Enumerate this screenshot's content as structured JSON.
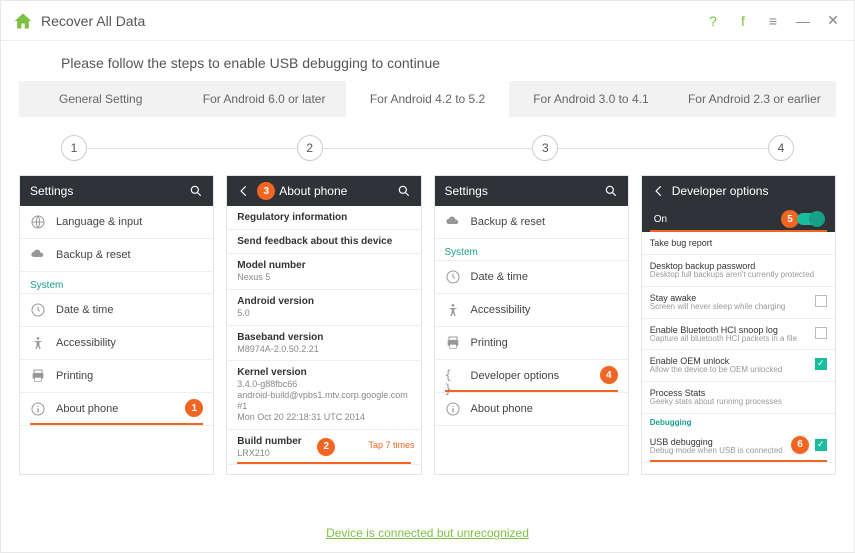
{
  "titlebar": {
    "title": "Recover All Data"
  },
  "instruction": "Please follow the steps to enable USB debugging to continue",
  "tabs": [
    "General Setting",
    "For Android 6.0 or later",
    "For Android 4.2 to 5.2",
    "For Android 3.0 to 4.1",
    "For Android 2.3 or earlier"
  ],
  "active_tab": 2,
  "steps": [
    "1",
    "2",
    "3",
    "4"
  ],
  "panel1": {
    "header": "Settings",
    "rows": [
      {
        "icon": "globe",
        "label": "Language & input"
      },
      {
        "icon": "cloud",
        "label": "Backup & reset"
      }
    ],
    "section": "System",
    "system_rows": [
      {
        "icon": "clock",
        "label": "Date & time"
      },
      {
        "icon": "accessibility",
        "label": "Accessibility"
      },
      {
        "icon": "printer",
        "label": "Printing"
      },
      {
        "icon": "info",
        "label": "About phone",
        "badge": "1",
        "underline": true
      }
    ]
  },
  "panel2": {
    "header": "About phone",
    "badge": "3",
    "rows": [
      {
        "label": "Regulatory information"
      },
      {
        "label": "Send feedback about this device"
      }
    ],
    "info": [
      {
        "label": "Model number",
        "value": "Nexus 5"
      },
      {
        "label": "Android version",
        "value": "5.0"
      },
      {
        "label": "Baseband version",
        "value": "M8974A-2.0.50.2.21"
      },
      {
        "label": "Kernel version",
        "value": "3.4.0-g88fbc66\nandroid-build@vpbs1.mtv.corp.google.com #1\nMon Oct 20 22:18:31 UTC 2014"
      },
      {
        "label": "Build number",
        "value": "LRX210",
        "badge": "2",
        "tap": "Tap 7 times",
        "underline": true
      }
    ]
  },
  "panel3": {
    "header": "Settings",
    "rows": [
      {
        "icon": "cloud",
        "label": "Backup & reset"
      }
    ],
    "section": "System",
    "system_rows": [
      {
        "icon": "clock",
        "label": "Date & time"
      },
      {
        "icon": "accessibility",
        "label": "Accessibility"
      },
      {
        "icon": "printer",
        "label": "Printing"
      },
      {
        "icon": "braces",
        "label": "Developer options",
        "badge": "4",
        "underline": true
      },
      {
        "icon": "info",
        "label": "About phone"
      }
    ]
  },
  "panel4": {
    "header": "Developer options",
    "sub": {
      "label": "On",
      "badge": "5"
    },
    "rows": [
      {
        "title": "Take bug report"
      },
      {
        "title": "Desktop backup password",
        "desc": "Desktop full backups aren't currently protected"
      },
      {
        "title": "Stay awake",
        "desc": "Screen will never sleep while charging",
        "check": false
      },
      {
        "title": "Enable Bluetooth HCI snoop log",
        "desc": "Capture all bluetooth HCI packets in a file",
        "check": false
      },
      {
        "title": "Enable OEM unlock",
        "desc": "Allow the device to be OEM unlocked",
        "check": true
      },
      {
        "title": "Process Stats",
        "desc": "Geeky stats about running processes"
      }
    ],
    "section": "Debugging",
    "debug": {
      "title": "USB debugging",
      "desc": "Debug mode when USB is connected",
      "badge": "6",
      "check": true,
      "underline": true
    }
  },
  "footer": "Device is connected but unrecognized",
  "chart_data": null
}
